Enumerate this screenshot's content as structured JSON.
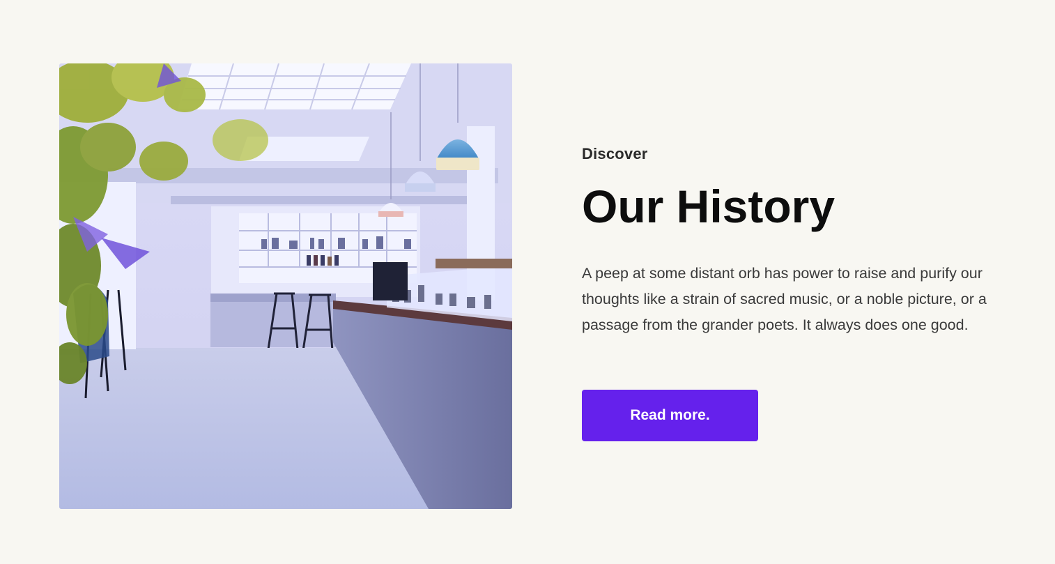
{
  "about_section": {
    "image_alt": "Bright cafe interior with counter, pendant lamps and bar stools",
    "eyebrow": "Discover",
    "title": "Our History",
    "body": "A peep at some distant orb has power to raise and purify our thoughts like a strain of sacred music, or a noble picture, or a passage from the grander poets. It always does one good.",
    "cta_label": "Read more."
  },
  "colors": {
    "background": "#f8f7f2",
    "accent": "#6521ec",
    "heading": "#0d0d0d",
    "text": "#3a3a3a"
  }
}
